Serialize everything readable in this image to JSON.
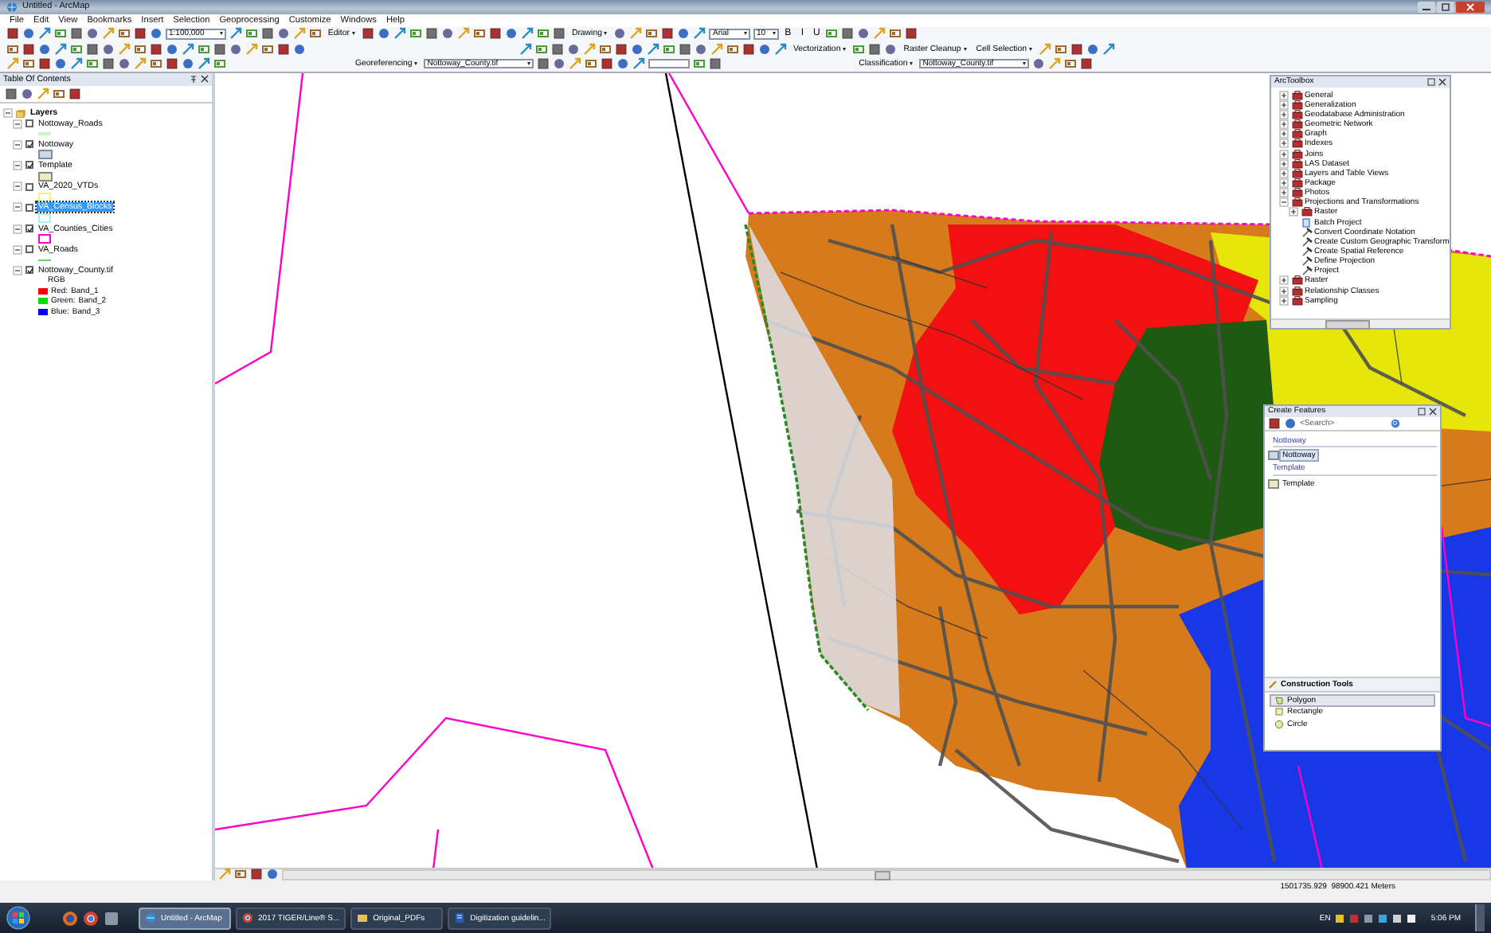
{
  "window": {
    "title": "Untitled - ArcMap"
  },
  "menu": [
    "File",
    "Edit",
    "View",
    "Bookmarks",
    "Insert",
    "Selection",
    "Geoprocessing",
    "Customize",
    "Windows",
    "Help"
  ],
  "toolbars": [
    [
      {
        "kind": "combo",
        "text": "1:100,000"
      },
      {
        "kind": "menu",
        "text": "Editor"
      },
      {
        "kind": "menu",
        "text": "Drawing"
      },
      {
        "kind": "combo",
        "text": "Arial"
      },
      {
        "kind": "combo",
        "text": "10"
      },
      {
        "kind": "format",
        "text": "B"
      },
      {
        "kind": "format",
        "text": "I"
      },
      {
        "kind": "format",
        "text": "U"
      }
    ],
    [
      {
        "kind": "menu",
        "text": "Vectorization"
      },
      {
        "kind": "menu",
        "text": "Raster Cleanup"
      },
      {
        "kind": "menu",
        "text": "Cell Selection"
      }
    ],
    [
      {
        "kind": "menu",
        "text": "Georeferencing"
      },
      {
        "kind": "combo",
        "text": "Nottoway_County.tif"
      },
      {
        "kind": "field"
      },
      {
        "kind": "menu",
        "text": "Classification"
      },
      {
        "kind": "combo",
        "text": "Nottoway_County.tif"
      }
    ]
  ],
  "toc": {
    "title": "Table Of Contents",
    "root": "Layers",
    "layers": [
      {
        "name": "Nottoway_Roads",
        "checked": false,
        "selected": false,
        "expanded": true,
        "kind": "line",
        "color": "#c8f5c0"
      },
      {
        "name": "Nottoway",
        "checked": true,
        "selected": false,
        "expanded": true,
        "kind": "box",
        "color": "#c6dcf0"
      },
      {
        "name": "Template",
        "checked": true,
        "selected": false,
        "expanded": true,
        "kind": "box",
        "color": "#ecebc0"
      },
      {
        "name": "VA_2020_VTDs",
        "checked": false,
        "selected": false,
        "expanded": true,
        "kind": "outline",
        "color": "#f5f070"
      },
      {
        "name": "VA_Census_Blocks",
        "checked": false,
        "selected": true,
        "expanded": true,
        "kind": "outline",
        "color": "#a8f0e4"
      },
      {
        "name": "VA_Counties_Cities",
        "checked": true,
        "selected": false,
        "expanded": true,
        "kind": "outline",
        "color": "#ff00cc"
      },
      {
        "name": "VA_Roads",
        "checked": false,
        "selected": false,
        "expanded": true,
        "kind": "line",
        "color": "#70cc70"
      },
      {
        "name": "Nottoway_County.tif",
        "checked": true,
        "selected": false,
        "expanded": true,
        "kind": "raster",
        "legend": {
          "header": "RGB",
          "bands": [
            {
              "label": "Red:",
              "band": "Band_1",
              "color": "#ff0000"
            },
            {
              "label": "Green:",
              "band": "Band_2",
              "color": "#00e000"
            },
            {
              "label": "Blue:",
              "band": "Band_3",
              "color": "#0000ff"
            }
          ]
        }
      }
    ]
  },
  "toolbox": {
    "title": "ArcToolbox",
    "items": [
      {
        "name": "General",
        "kind": "toolset",
        "expanded": false
      },
      {
        "name": "Generalization",
        "kind": "toolset",
        "expanded": false
      },
      {
        "name": "Geodatabase Administration",
        "kind": "toolset",
        "expanded": false
      },
      {
        "name": "Geometric Network",
        "kind": "toolset",
        "expanded": false
      },
      {
        "name": "Graph",
        "kind": "toolset",
        "expanded": false
      },
      {
        "name": "Indexes",
        "kind": "toolset",
        "expanded": false
      },
      {
        "name": "Joins",
        "kind": "toolset",
        "expanded": false
      },
      {
        "name": "LAS Dataset",
        "kind": "toolset",
        "expanded": false
      },
      {
        "name": "Layers and Table Views",
        "kind": "toolset",
        "expanded": false
      },
      {
        "name": "Package",
        "kind": "toolset",
        "expanded": false
      },
      {
        "name": "Photos",
        "kind": "toolset",
        "expanded": false
      },
      {
        "name": "Projections and Transformations",
        "kind": "toolset",
        "expanded": true,
        "children": [
          {
            "name": "Raster",
            "kind": "toolset",
            "expanded": false
          },
          {
            "name": "Batch Project",
            "kind": "script"
          },
          {
            "name": "Convert Coordinate Notation",
            "kind": "tool"
          },
          {
            "name": "Create Custom Geographic Transform",
            "kind": "tool"
          },
          {
            "name": "Create Spatial Reference",
            "kind": "tool"
          },
          {
            "name": "Define Projection",
            "kind": "tool"
          },
          {
            "name": "Project",
            "kind": "tool"
          }
        ]
      },
      {
        "name": "Raster",
        "kind": "toolset",
        "expanded": false
      },
      {
        "name": "Relationship Classes",
        "kind": "toolset",
        "expanded": false
      },
      {
        "name": "Sampling",
        "kind": "toolset",
        "expanded": false
      }
    ]
  },
  "create_features": {
    "title": "Create Features",
    "search": {
      "placeholder": "<Search>"
    },
    "groups": [
      {
        "name": "Nottoway",
        "templates": [
          {
            "name": "Nottoway",
            "selected": true,
            "color": "#c6dcf0"
          }
        ]
      },
      {
        "name": "Template",
        "templates": [
          {
            "name": "Template",
            "selected": false,
            "color": "#ecebc0"
          }
        ]
      }
    ],
    "construction_title": "Construction Tools",
    "tools": [
      {
        "name": "Polygon",
        "kind": "polygon",
        "selected": true
      },
      {
        "name": "Rectangle",
        "kind": "rectangle",
        "selected": false
      },
      {
        "name": "Circle",
        "kind": "circle",
        "selected": false
      }
    ]
  },
  "status_bar": {
    "coordinates": "1501735.929  98900.421 Meters"
  },
  "taskbar": {
    "tasks": [
      {
        "label": "Untitled - ArcMap",
        "kind": "arcmap",
        "selected": true
      },
      {
        "label": "2017 TIGER/Line® S...",
        "kind": "browser",
        "selected": false
      },
      {
        "label": "Original_PDFs",
        "kind": "folder",
        "selected": false
      },
      {
        "label": "Digitization guidelin...",
        "kind": "word",
        "selected": false
      }
    ],
    "language": "EN",
    "clock": "5:06 PM"
  }
}
